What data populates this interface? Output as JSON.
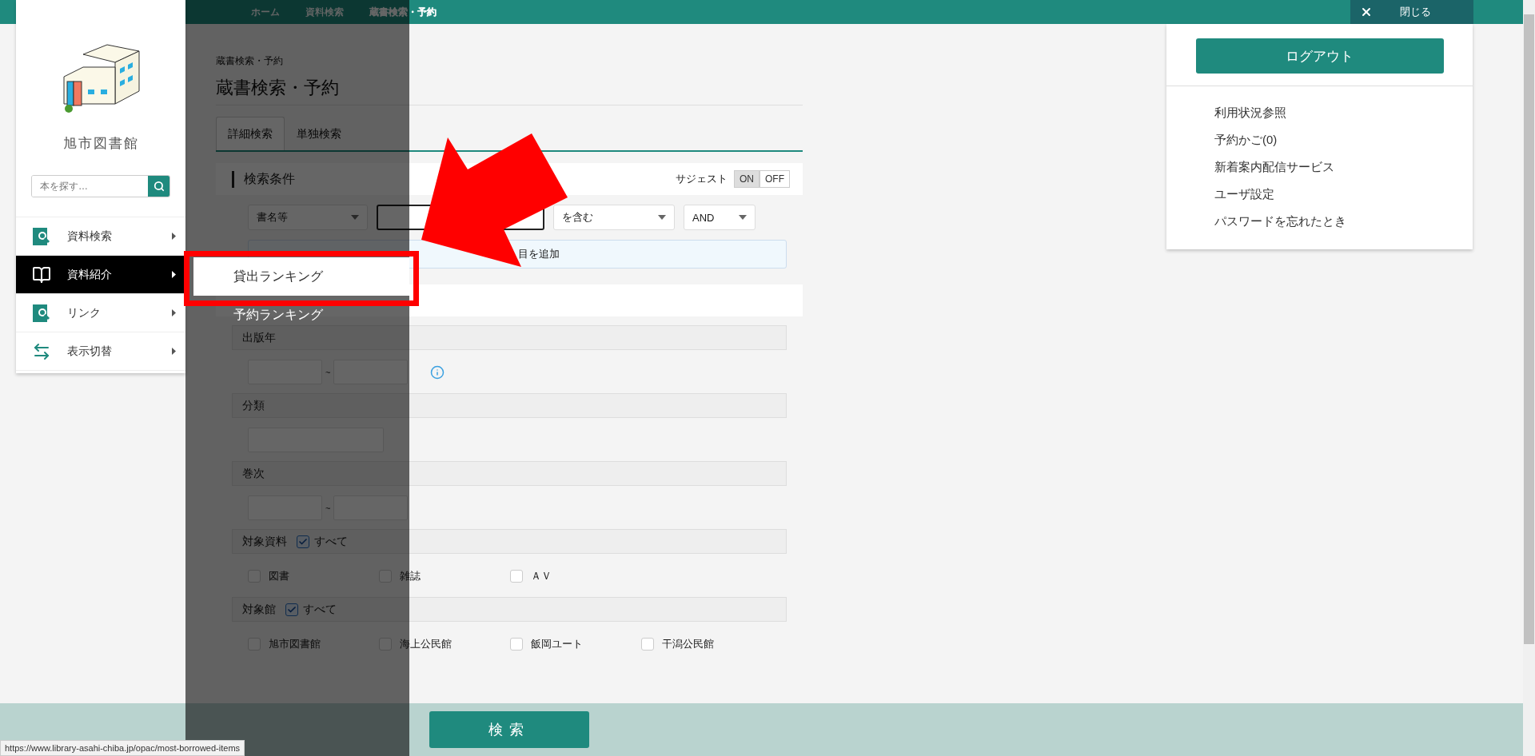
{
  "top_bar": {
    "breadcrumbs": [
      {
        "label": "ホーム",
        "current": false
      },
      {
        "label": "資料検索",
        "current": false
      },
      {
        "label": "蔵書検索・予約",
        "current": true
      }
    ],
    "close_label": "閉じる"
  },
  "sidebar": {
    "library_name": "旭市図書館",
    "search": {
      "placeholder": "本を探す…"
    },
    "items": [
      {
        "label": "資料検索",
        "kind": "search",
        "selected": false
      },
      {
        "label": "資料紹介",
        "kind": "book",
        "selected": true
      },
      {
        "label": "リンク",
        "kind": "search",
        "selected": false
      },
      {
        "label": "表示切替",
        "kind": "swap",
        "selected": false
      }
    ]
  },
  "submenu": {
    "items": [
      {
        "label": "貸出ランキング",
        "selected": true
      },
      {
        "label": "予約ランキング",
        "selected": false
      }
    ]
  },
  "main": {
    "page_caption": "蔵書検索・予約",
    "title": "蔵書検索・予約",
    "tabs": [
      {
        "label": "詳細検索",
        "selected": true
      },
      {
        "label": "単独検索",
        "selected": false
      }
    ],
    "conditions": {
      "heading": "検索条件",
      "suggest": {
        "label": "サジェスト",
        "options": [
          {
            "label": "ON",
            "selected": true
          },
          {
            "label": "OFF",
            "selected": false
          }
        ]
      },
      "row": {
        "field": "書名等",
        "match": "を含む",
        "operator": "AND"
      },
      "add_label": "目を追加"
    },
    "filters": [
      {
        "kind": "range",
        "label": "出版年",
        "info": true,
        "separator": "~"
      },
      {
        "kind": "single",
        "label": "分類",
        "info": false
      },
      {
        "kind": "range",
        "label": "巻次",
        "info": false,
        "separator": "~"
      },
      {
        "kind": "checks",
        "label": "対象資料",
        "info": false,
        "all": {
          "label": "すべて",
          "checked": true
        },
        "options": [
          {
            "label": "図書",
            "checked": false
          },
          {
            "label": "雑誌",
            "checked": false
          },
          {
            "label": "ＡＶ",
            "checked": false
          }
        ]
      },
      {
        "kind": "checks",
        "label": "対象館",
        "info": false,
        "all": {
          "label": "すべて",
          "checked": true
        },
        "options": [
          {
            "label": "旭市図書館",
            "checked": false
          },
          {
            "label": "海上公民館",
            "checked": false
          },
          {
            "label": "飯岡ユート",
            "checked": false
          },
          {
            "label": "干潟公民館",
            "checked": false
          }
        ]
      }
    ],
    "search_button": "検索"
  },
  "user_menu": {
    "logout": "ログアウト",
    "links": [
      {
        "label": "利用状況参照"
      },
      {
        "label": "予約かご(0)"
      },
      {
        "label": "新着案内配信サービス"
      },
      {
        "label": "ユーザ設定"
      },
      {
        "label": "パスワードを忘れたとき"
      }
    ]
  },
  "status_url": "https://www.library-asahi-chiba.jp/opac/most-borrowed-items"
}
